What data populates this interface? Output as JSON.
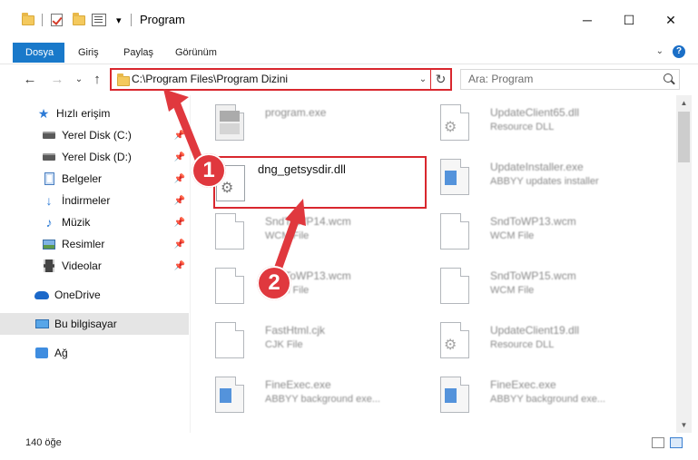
{
  "window": {
    "title": "Program",
    "minimize_glyph": "─",
    "maximize_glyph": "☐",
    "close_glyph": "✕"
  },
  "quick_access_toolbar": {
    "dropdown_glyph": "▾"
  },
  "ribbon": {
    "tabs": [
      "Dosya",
      "Giriş",
      "Paylaş",
      "Görünüm"
    ],
    "help_glyph": "?",
    "collapse_glyph": "⌄"
  },
  "navigation": {
    "back_glyph": "←",
    "forward_glyph": "→",
    "recent_glyph": "⌄",
    "up_glyph": "↑",
    "address_path": "C:\\Program Files\\Program Dizini",
    "address_dropdown_glyph": "⌄",
    "refresh_glyph": "↻",
    "search_placeholder": "Ara: Program"
  },
  "sidebar": {
    "items": [
      {
        "label": "Hızlı erişim",
        "icon": "star-icon",
        "pinned": false
      },
      {
        "label": "Yerel Disk (C:)",
        "icon": "drive-icon",
        "pinned": true
      },
      {
        "label": "Yerel Disk (D:)",
        "icon": "drive-icon",
        "pinned": true
      },
      {
        "label": "Belgeler",
        "icon": "documents-icon",
        "pinned": true
      },
      {
        "label": "İndirmeler",
        "icon": "download-icon",
        "pinned": true
      },
      {
        "label": "Müzik",
        "icon": "music-icon",
        "pinned": true
      },
      {
        "label": "Resimler",
        "icon": "pictures-icon",
        "pinned": true
      },
      {
        "label": "Videolar",
        "icon": "videos-icon",
        "pinned": true
      },
      {
        "label": "OneDrive",
        "icon": "onedrive-icon",
        "pinned": false
      },
      {
        "label": "Bu bilgisayar",
        "icon": "computer-icon",
        "pinned": false,
        "selected": true
      },
      {
        "label": "Ağ",
        "icon": "network-icon",
        "pinned": false
      }
    ],
    "pin_glyph": "📌"
  },
  "files": {
    "left_column": [
      {
        "name": "program.exe",
        "desc": "",
        "icon": "exe-icon"
      },
      {
        "name": "dng_getsysdir.dll",
        "desc": "",
        "icon": "dll-gear-icon",
        "highlighted": true
      },
      {
        "name": "SndToWP14.wcm",
        "desc": "WCM File",
        "icon": "file-icon"
      },
      {
        "name": "SndToWP13.wcm",
        "desc": "WCM File",
        "icon": "file-icon"
      },
      {
        "name": "FastHtml.cjk",
        "desc": "CJK File",
        "icon": "file-icon"
      },
      {
        "name": "FineExec.exe",
        "desc": "ABBYY background exe...",
        "icon": "app-icon"
      }
    ],
    "right_column": [
      {
        "name": "UpdateClient65.dll",
        "desc": "Resource DLL",
        "icon": "dll-gear-icon"
      },
      {
        "name": "UpdateInstaller.exe",
        "desc": "ABBYY updates installer",
        "icon": "app-icon"
      },
      {
        "name": "SndToWP13.wcm",
        "desc": "WCM File",
        "icon": "file-icon"
      },
      {
        "name": "SndToWP15.wcm",
        "desc": "WCM File",
        "icon": "file-icon"
      },
      {
        "name": "UpdateClient19.dll",
        "desc": "Resource DLL",
        "icon": "dll-gear-icon"
      },
      {
        "name": "FineExec.exe",
        "desc": "ABBYY background exe...",
        "icon": "app-icon"
      }
    ]
  },
  "annotations": {
    "step1": "1",
    "step2": "2",
    "accent_color": "#d9272e"
  },
  "status": {
    "item_count": "140 öğe"
  },
  "scrollbar": {
    "up_glyph": "▲",
    "down_glyph": "▼"
  }
}
